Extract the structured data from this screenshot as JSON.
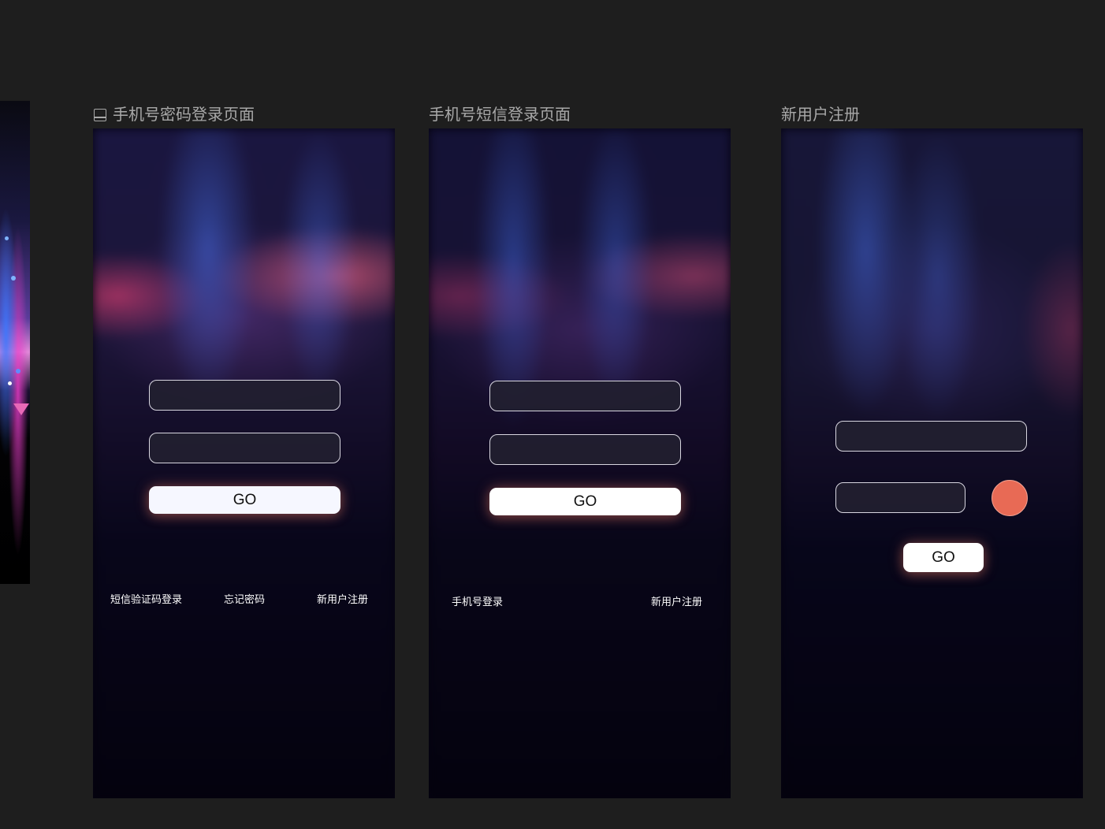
{
  "artboards": [
    {
      "label": "手机号密码登录页面",
      "go_label": "GO",
      "links": [
        "短信验证码登录",
        "忘记密码",
        "新用户注册"
      ]
    },
    {
      "label": "手机号短信登录页面",
      "go_label": "GO",
      "links": [
        "手机号登录",
        "新用户注册"
      ]
    },
    {
      "label": "新用户注册",
      "go_label": "GO"
    }
  ],
  "icons": {
    "artboard_frame": "frame-icon",
    "code_button": "circle-button"
  },
  "colors": {
    "workspace_bg": "#1e1e1e",
    "artboard_bg": "#050310",
    "label": "#a8a8a8",
    "go_button": "#f6f7ff",
    "code_button": "#e86a55"
  }
}
